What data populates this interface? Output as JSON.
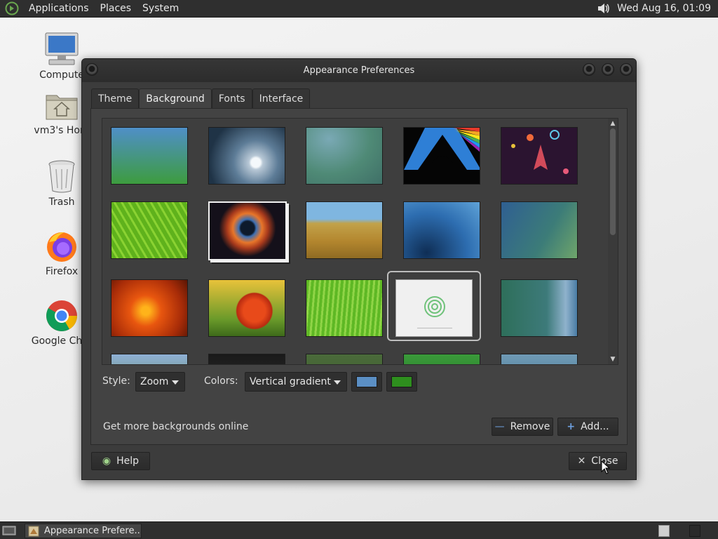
{
  "top_panel": {
    "menus": [
      "Applications",
      "Places",
      "System"
    ],
    "clock": "Wed Aug 16, 01:09"
  },
  "desktop": {
    "icons": [
      {
        "label": "Compute",
        "icon": "computer-icon"
      },
      {
        "label": "vm3's Hom",
        "icon": "home-folder-icon"
      },
      {
        "label": "Trash",
        "icon": "trash-icon"
      },
      {
        "label": "Firefox",
        "icon": "firefox-icon"
      },
      {
        "label": "Google Chro",
        "icon": "chrome-icon"
      }
    ]
  },
  "window": {
    "title": "Appearance Preferences",
    "tabs": [
      "Theme",
      "Background",
      "Fonts",
      "Interface"
    ],
    "active_tab": "Background",
    "style_label": "Style:",
    "style_value": "Zoom",
    "colors_label": "Colors:",
    "colors_value": "Vertical gradient",
    "color_primary": "#5b8fc4",
    "color_secondary": "#2e8f1e",
    "more_link": "Get more backgrounds online",
    "remove_label": "Remove",
    "add_label": "Add...",
    "help_label": "Help",
    "close_label": "Close"
  },
  "taskbar": {
    "task_label": "Appearance Prefere..."
  }
}
